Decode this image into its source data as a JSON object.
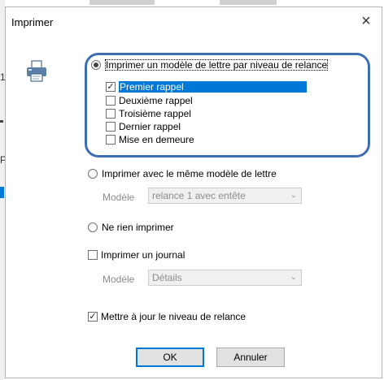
{
  "dialog": {
    "title": "Imprimer",
    "close_symbol": "×"
  },
  "options": {
    "option1_label": "Imprimer un modèle de lettre par niveau de relance",
    "levels": [
      {
        "label": "Premier rappel",
        "checked": true
      },
      {
        "label": "Deuxième rappel",
        "checked": false
      },
      {
        "label": "Troisième rappel",
        "checked": false
      },
      {
        "label": "Dernier rappel",
        "checked": false
      },
      {
        "label": "Mise en demeure",
        "checked": false
      }
    ],
    "option2_label": "Imprimer avec le même modèle de lettre",
    "model_label_1": "Modèle",
    "model_value_1": "relance 1 avec entête",
    "option3_label": "Ne rien imprimer",
    "journal_label": "Imprimer un journal",
    "model_label_2": "Modèle",
    "model_value_2": "Détails",
    "update_label": "Mettre à jour le niveau de relance"
  },
  "buttons": {
    "ok": "OK",
    "cancel": "Annuler"
  },
  "background": {
    "fragment_1": "1",
    "fragment_2": "P"
  },
  "colors": {
    "selection": "#0078d7",
    "highlight_outline": "#3d6eb4"
  }
}
